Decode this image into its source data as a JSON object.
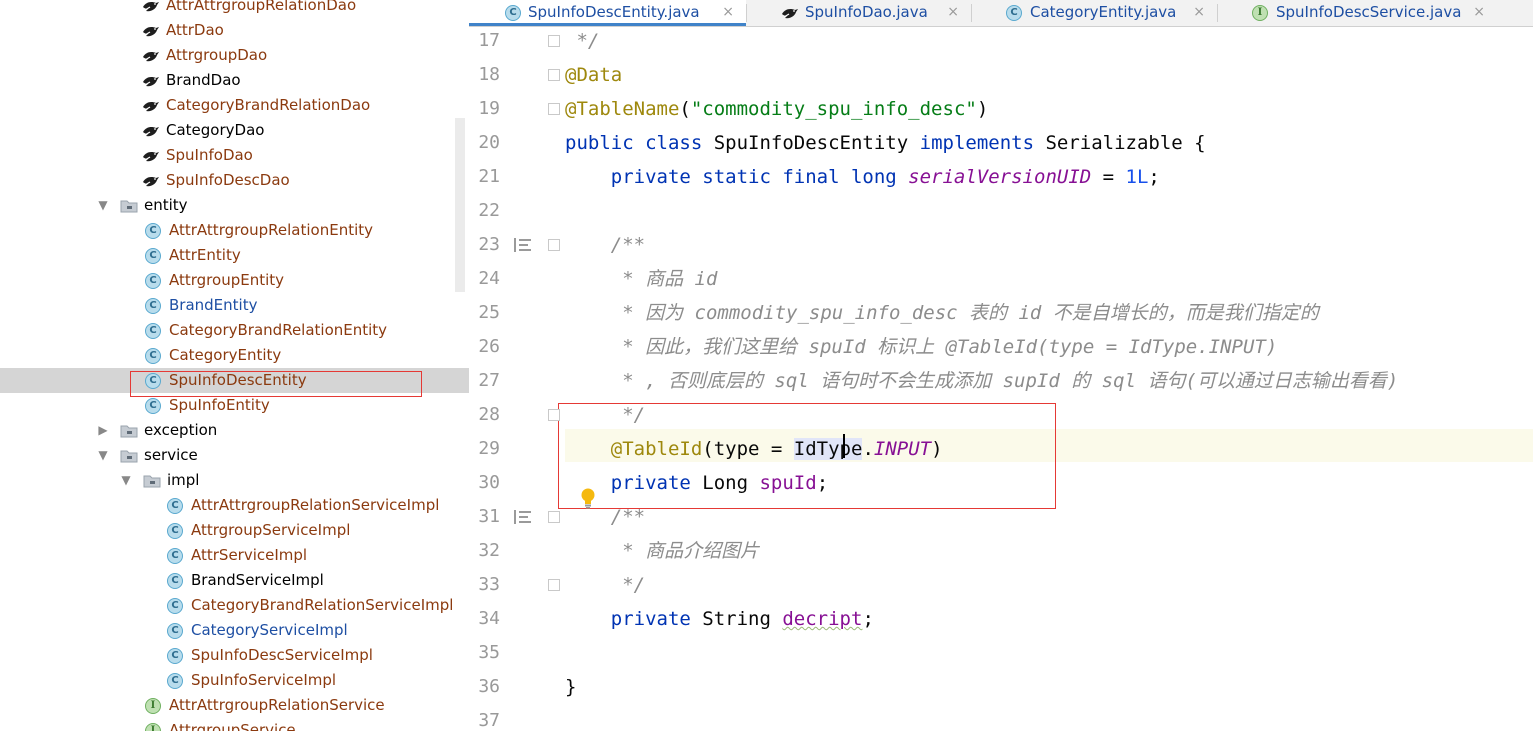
{
  "tree": {
    "items": [
      {
        "label": "AttrAttrgroupRelationDao",
        "icon": "dao-bird-icon",
        "color": "#8b3a0f"
      },
      {
        "label": "AttrDao",
        "icon": "dao-bird-icon",
        "color": "#8b3a0f"
      },
      {
        "label": "AttrgroupDao",
        "icon": "dao-bird-icon",
        "color": "#8b3a0f"
      },
      {
        "label": "BrandDao",
        "icon": "dao-bird-icon",
        "color": "#000000"
      },
      {
        "label": "CategoryBrandRelationDao",
        "icon": "dao-bird-icon",
        "color": "#8b3a0f"
      },
      {
        "label": "CategoryDao",
        "icon": "dao-bird-icon",
        "color": "#000000"
      },
      {
        "label": "SpuInfoDao",
        "icon": "dao-bird-icon",
        "color": "#8b3a0f"
      },
      {
        "label": "SpuInfoDescDao",
        "icon": "dao-bird-icon",
        "color": "#8b3a0f"
      },
      {
        "label": "entity",
        "icon": "folder-icon",
        "color": "#000000",
        "expanded": true
      },
      {
        "label": "AttrAttrgroupRelationEntity",
        "icon": "class-icon",
        "color": "#8b3a0f"
      },
      {
        "label": "AttrEntity",
        "icon": "class-icon",
        "color": "#8b3a0f"
      },
      {
        "label": "AttrgroupEntity",
        "icon": "class-icon",
        "color": "#8b3a0f"
      },
      {
        "label": "BrandEntity",
        "icon": "class-icon",
        "color": "#1e4fa3"
      },
      {
        "label": "CategoryBrandRelationEntity",
        "icon": "class-icon",
        "color": "#8b3a0f"
      },
      {
        "label": "CategoryEntity",
        "icon": "class-icon",
        "color": "#8b3a0f"
      },
      {
        "label": "SpuInfoDescEntity",
        "icon": "class-icon",
        "color": "#8b3a0f",
        "selected": true
      },
      {
        "label": "SpuInfoEntity",
        "icon": "class-icon",
        "color": "#8b3a0f"
      },
      {
        "label": "exception",
        "icon": "folder-icon",
        "color": "#000000",
        "expanded": false
      },
      {
        "label": "service",
        "icon": "folder-icon",
        "color": "#000000",
        "expanded": true
      },
      {
        "label": "impl",
        "icon": "folder-icon",
        "color": "#000000",
        "expanded": true
      },
      {
        "label": "AttrAttrgroupRelationServiceImpl",
        "icon": "class-icon",
        "color": "#8b3a0f"
      },
      {
        "label": "AttrgroupServiceImpl",
        "icon": "class-icon",
        "color": "#8b3a0f"
      },
      {
        "label": "AttrServiceImpl",
        "icon": "class-icon",
        "color": "#8b3a0f"
      },
      {
        "label": "BrandServiceImpl",
        "icon": "class-icon",
        "color": "#000000"
      },
      {
        "label": "CategoryBrandRelationServiceImpl",
        "icon": "class-icon",
        "color": "#8b3a0f"
      },
      {
        "label": "CategoryServiceImpl",
        "icon": "class-icon",
        "color": "#1e4fa3"
      },
      {
        "label": "SpuInfoDescServiceImpl",
        "icon": "class-icon",
        "color": "#8b3a0f"
      },
      {
        "label": "SpuInfoServiceImpl",
        "icon": "class-icon",
        "color": "#8b3a0f"
      },
      {
        "label": "AttrAttrgroupRelationService",
        "icon": "interface-icon",
        "color": "#8b3a0f"
      },
      {
        "label": "AttrgroupService",
        "icon": "interface-icon",
        "color": "#8b3a0f"
      }
    ]
  },
  "tabs": [
    {
      "label": "SpuInfoDescEntity.java",
      "icon": "class-icon",
      "active": true,
      "close": "×",
      "color": "#1e4fa3"
    },
    {
      "label": "SpuInfoDao.java",
      "icon": "dao-bird-icon",
      "active": false,
      "close": "×",
      "color": "#1e4fa3"
    },
    {
      "label": "CategoryEntity.java",
      "icon": "class-icon",
      "active": false,
      "close": "×",
      "color": "#1e4fa3"
    },
    {
      "label": "SpuInfoDescService.java",
      "icon": "interface-icon",
      "active": false,
      "close": "×",
      "color": "#1e4fa3"
    }
  ],
  "icon_letters": {
    "class": "C",
    "interface": "I"
  },
  "editor": {
    "line_numbers": [
      "17",
      "18",
      "19",
      "20",
      "21",
      "22",
      "23",
      "24",
      "25",
      "26",
      "27",
      "28",
      "29",
      "30",
      "31",
      "32",
      "33",
      "34",
      "35",
      "36",
      "37"
    ],
    "lines": [
      [
        {
          "t": " */",
          "c": "cmt"
        }
      ],
      [
        {
          "t": "@Data",
          "c": "ann"
        }
      ],
      [
        {
          "t": "@TableName",
          "c": "ann"
        },
        {
          "t": "(",
          "c": ""
        },
        {
          "t": "\"commodity_spu_info_desc\"",
          "c": "str"
        },
        {
          "t": ")",
          "c": ""
        }
      ],
      [
        {
          "t": "public class ",
          "c": "kw"
        },
        {
          "t": "SpuInfoDescEntity ",
          "c": ""
        },
        {
          "t": "implements ",
          "c": "kw"
        },
        {
          "t": "Serializable {",
          "c": ""
        }
      ],
      [
        {
          "t": "    private static final long ",
          "c": "kw"
        },
        {
          "t": "serialVersionUID",
          "c": "static"
        },
        {
          "t": " = ",
          "c": ""
        },
        {
          "t": "1L",
          "c": "num"
        },
        {
          "t": ";",
          "c": ""
        }
      ],
      [],
      [
        {
          "t": "    /**",
          "c": "cmt"
        }
      ],
      [
        {
          "t": "     * 商品 id",
          "c": "cmt"
        }
      ],
      [
        {
          "t": "     * 因为 commodity_spu_info_desc 表的 id 不是自增长的，而是我们指定的",
          "c": "cmt"
        }
      ],
      [
        {
          "t": "     * 因此，我们这里给 spuId 标识上 @TableId(type = IdType.INPUT)",
          "c": "cmt"
        }
      ],
      [
        {
          "t": "     * , 否则底层的 sql 语句时不会生成添加 supId 的 sql 语句(可以通过日志输出看看)",
          "c": "cmt"
        }
      ],
      [
        {
          "t": "     */",
          "c": "cmt"
        }
      ],
      [
        {
          "t": "    ",
          "c": ""
        },
        {
          "t": "@TableId",
          "c": "ann"
        },
        {
          "t": "(type = ",
          "c": ""
        },
        {
          "t": "IdType",
          "c": "sel"
        },
        {
          "t": ".",
          "c": ""
        },
        {
          "t": "INPUT",
          "c": "static"
        },
        {
          "t": ")",
          "c": ""
        }
      ],
      [
        {
          "t": "    private ",
          "c": "kw"
        },
        {
          "t": "Long ",
          "c": ""
        },
        {
          "t": "spuId",
          "c": "fld"
        },
        {
          "t": ";",
          "c": ""
        }
      ],
      [
        {
          "t": "    /**",
          "c": "cmt"
        }
      ],
      [
        {
          "t": "     * 商品介绍图片",
          "c": "cmt"
        }
      ],
      [
        {
          "t": "     */",
          "c": "cmt"
        }
      ],
      [
        {
          "t": "    private ",
          "c": "kw"
        },
        {
          "t": "String ",
          "c": ""
        },
        {
          "t": "decript",
          "c": "fld wavy"
        },
        {
          "t": ";",
          "c": ""
        }
      ],
      [],
      [
        {
          "t": "}",
          "c": ""
        }
      ],
      []
    ],
    "current_line": "29",
    "fold_markers_at_lines": [
      "17",
      "18",
      "19",
      "23",
      "28",
      "31",
      "33"
    ],
    "doc_icon_at_lines": [
      "23",
      "31"
    ],
    "bulb_at_line": "30",
    "bulb_icon": "lightbulb-icon"
  },
  "colors": {
    "highlight_box": "#e53935",
    "selected_row": "#d5d5d5",
    "current_line": "#fbfaea",
    "tab_underline": "#4083c9"
  }
}
